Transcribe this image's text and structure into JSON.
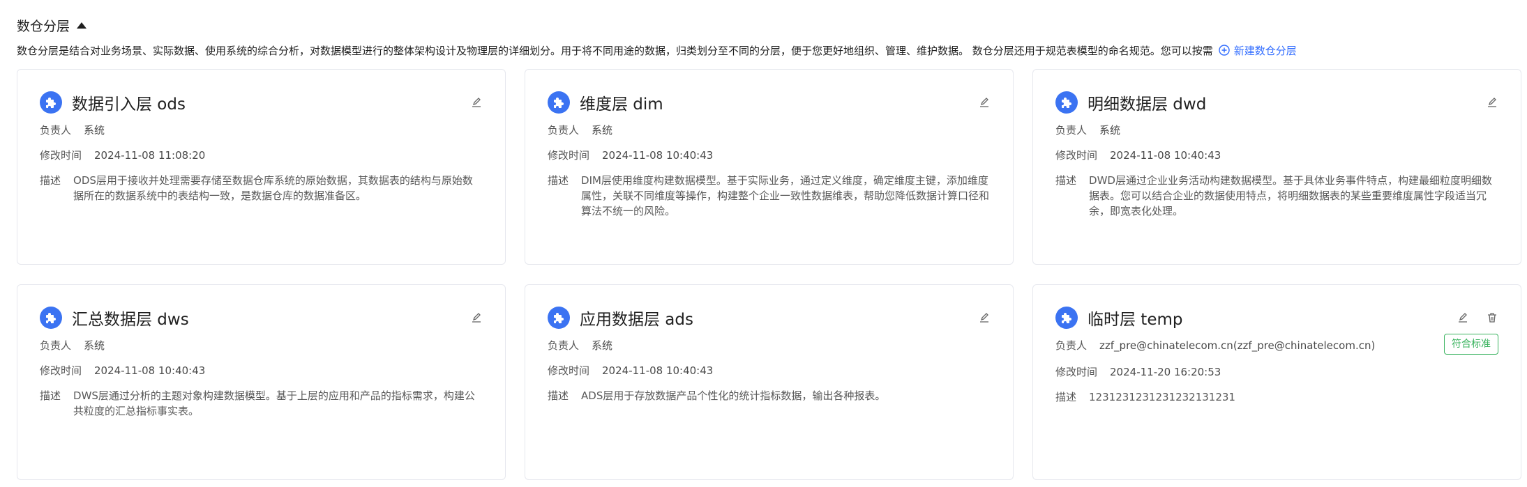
{
  "section": {
    "title": "数仓分层",
    "intro_text": "数仓分层是结合对业务场景、实际数据、使用系统的综合分析，对数据模型进行的整体架构设计及物理层的详细划分。用于将不同用途的数据，归类划分至不同的分层，便于您更好地组织、管理、维护数据。 数仓分层还用于规范表模型的命名规范。您可以按需",
    "new_link": "新建数仓分层"
  },
  "labels": {
    "owner": "负责人",
    "modified": "修改时间",
    "desc": "描述"
  },
  "cards": [
    {
      "title": "数据引入层 ods",
      "owner": "系统",
      "modified": "2024-11-08 11:08:20",
      "desc": "ODS层用于接收并处理需要存储至数据仓库系统的原始数据，其数据表的结构与原始数据所在的数据系统中的表结构一致，是数据仓库的数据准备区。"
    },
    {
      "title": "维度层 dim",
      "owner": "系统",
      "modified": "2024-11-08 10:40:43",
      "desc": "DIM层使用维度构建数据模型。基于实际业务，通过定义维度，确定维度主键，添加维度属性，关联不同维度等操作，构建整个企业一致性数据维表，帮助您降低数据计算口径和算法不统一的风险。"
    },
    {
      "title": "明细数据层 dwd",
      "owner": "系统",
      "modified": "2024-11-08 10:40:43",
      "desc": "DWD层通过企业业务活动构建数据模型。基于具体业务事件特点，构建最细粒度明细数据表。您可以结合企业的数据使用特点，将明细数据表的某些重要维度属性字段适当冗余，即宽表化处理。"
    },
    {
      "title": "汇总数据层 dws",
      "owner": "系统",
      "modified": "2024-11-08 10:40:43",
      "desc": "DWS层通过分析的主题对象构建数据模型。基于上层的应用和产品的指标需求，构建公共粒度的汇总指标事实表。"
    },
    {
      "title": "应用数据层 ads",
      "owner": "系统",
      "modified": "2024-11-08 10:40:43",
      "desc": "ADS层用于存放数据产品个性化的统计指标数据，输出各种报表。"
    },
    {
      "title": "临时层 temp",
      "owner": "zzf_pre@chinatelecom.cn(zzf_pre@chinatelecom.cn)",
      "modified": "2024-11-20 16:20:53",
      "desc": "1231231231231232131231",
      "badge": "符合标准"
    }
  ]
}
